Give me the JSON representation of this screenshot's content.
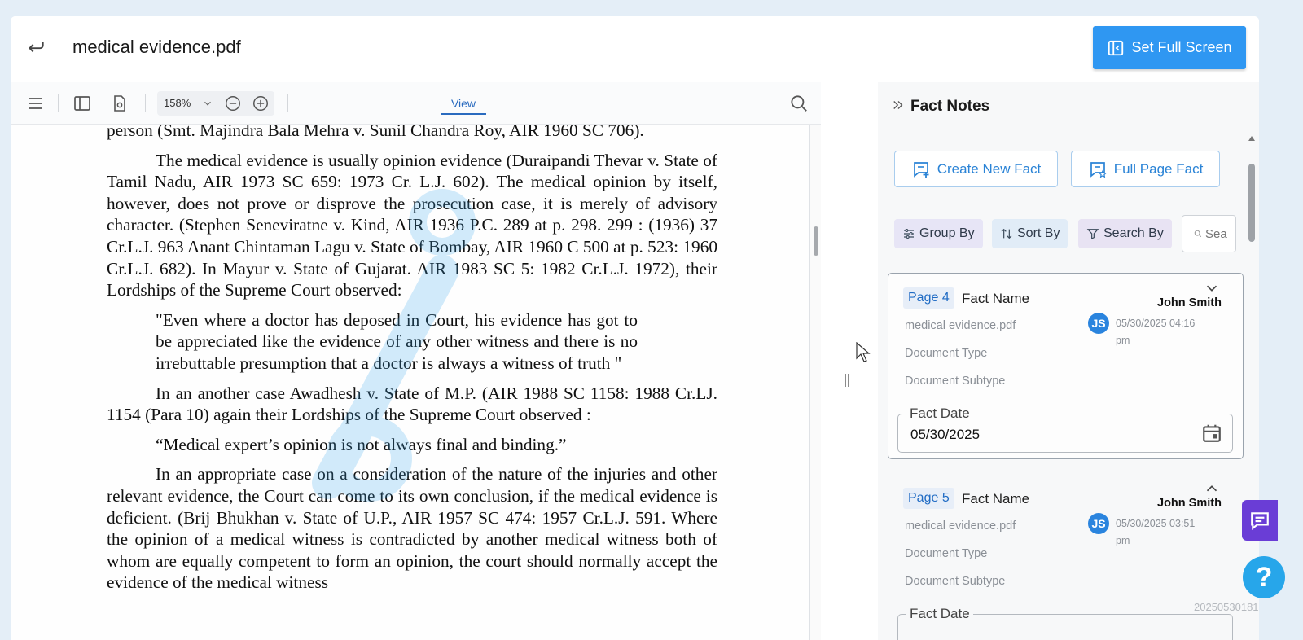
{
  "header": {
    "title": "medical evidence.pdf",
    "fullscreen_label": "Set Full Screen"
  },
  "toolbar": {
    "zoom": "158%",
    "view_tab": "View"
  },
  "document": {
    "paragraphs": [
      "person (Smt. Majindra Bala Mehra v. Sunil Chandra Roy, AIR 1960 SC 706).",
      "The medical evidence is usually opinion evidence (Duraipandi Thevar v. State of Tamil Nadu, AIR 1973 SC 659: 1973 Cr. L.J. 602). The medical opinion by itself, however, does not prove or disprove the prosecution case, it is merely of advisory character. (Stephen Seneviratne v. Kind, AIR 1936 P.C. 289 at p. 298. 299 : (1936) 37 Cr.L.J. 963 Anant Chintaman Lagu v. State of Bombay, AIR 1960 C 500 at p. 523: 1960 Cr.L.J. 682). In Mayur v. State of Gujarat. AIR 1983 SC 5: 1982 Cr.L.J. 1972), their Lordships of the Supreme Court observed:",
      "\"Even where a doctor has deposed in Court, his evidence has got to be appreciated like the evidence of any other witness and there is no irrebuttable presumption that a doctor is always a witness of truth \"",
      "In an another case Awadhesh v. State of M.P. (AIR 1988 SC 1158: 1988 Cr.LJ. 1154 (Para 10) again their Lordships of the Supreme Court observed :",
      "“Medical expert’s opinion is not always final and binding.”",
      "In an appropriate case on a  consideration of the nature of the injuries and other relevant evidence, the Court can come to its own conclusion, if the medical evidence is deficient. (Brij Bhukhan v. State of U.P., AIR 1957 SC 474: 1957 Cr.L.J. 591. Where the opinion of a medical witness is contradicted by another medical witness both of whom are equally competent to form an opinion, the court should normally accept the evidence of the medical witness"
    ]
  },
  "panel": {
    "title": "Fact Notes",
    "create_label": "Create New Fact",
    "full_page_label": "Full Page Fact",
    "group_label": "Group By",
    "sort_label": "Sort By",
    "search_by_label": "Search By",
    "search_placeholder": "Sea",
    "cards": [
      {
        "page": "Page 4",
        "fact_name": "Fact Name",
        "author": "John Smith",
        "initials": "JS",
        "datetime": "05/30/2025 04:16 pm",
        "file": "medical evidence.pdf",
        "doc_type": "Document Type",
        "doc_subtype": "Document Subtype",
        "date_label": "Fact Date",
        "date_value": "05/30/2025"
      },
      {
        "page": "Page 5",
        "fact_name": "Fact Name",
        "author": "John Smith",
        "initials": "JS",
        "datetime": "05/30/2025 03:51 pm",
        "file": "medical evidence.pdf",
        "doc_type": "Document Type",
        "doc_subtype": "Document Subtype",
        "date_label": "Fact Date"
      }
    ]
  },
  "build_stamp": "20250530181",
  "colors": {
    "accent": "#2f97f2",
    "chat": "#6a3dd6",
    "help": "#27a6ea"
  }
}
